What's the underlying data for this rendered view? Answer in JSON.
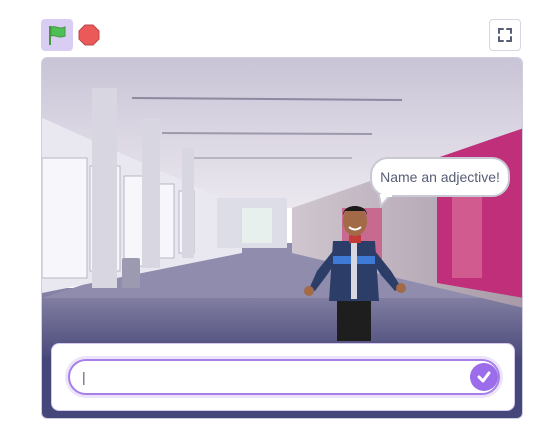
{
  "controls": {
    "green_flag_icon": "green-flag-icon",
    "stop_icon": "stop-sign-icon",
    "fullscreen_icon": "fullscreen-icon"
  },
  "stage": {
    "speech_bubble": "Name an adjective!",
    "answer_value": "|"
  },
  "colors": {
    "flag_bg": "#d9cdf4",
    "flag_green": "#4cbf56",
    "stop_red": "#ec5959",
    "accent_purple": "#9b6dea"
  }
}
